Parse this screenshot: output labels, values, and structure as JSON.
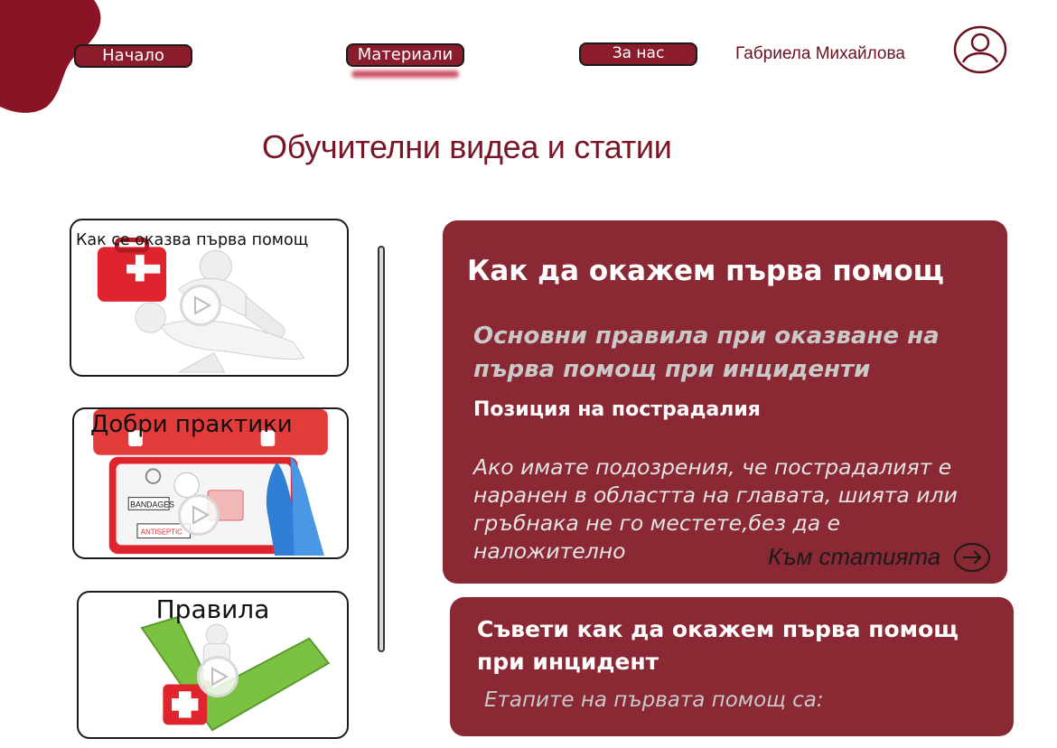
{
  "nav": {
    "home": "Начало",
    "materials": "Материали",
    "about": "За нас"
  },
  "user": {
    "name": "Габриела Михайлова",
    "avatar_icon": "user-circle-icon"
  },
  "page": {
    "title": "Обучителни видеа и статии"
  },
  "videos": [
    {
      "title": "Как се оказва първа помощ",
      "icon": "play-icon",
      "art": "cpr-figure-first-aid-kit"
    },
    {
      "title": "Добри практики",
      "icon": "play-icon",
      "art": "open-first-aid-kit",
      "labels": [
        "BANDAGES",
        "ANTISEPTIC"
      ]
    },
    {
      "title": "Правила",
      "icon": "play-icon",
      "art": "green-checkmark-first-aid-kit"
    }
  ],
  "articles": [
    {
      "title": "Как да окажем първа помощ",
      "subtitle": "Основни правила при оказване на първа помощ при инциденти",
      "section": "Позиция на пострадалия",
      "body": "Ако имате подозрения, че пострадалият е наранен в областта на главата, шията или гръбнака не го местете,без да е наложително",
      "link": "Към статията",
      "link_icon": "arrow-right-circle-icon"
    },
    {
      "title": "Съвети как да окажем първа помощ при инцидент",
      "body": "Етапите на първата помощ са:"
    }
  ],
  "colors": {
    "brand": "#8a1c2c",
    "card": "#8a2834",
    "accent_red": "#e0242e"
  }
}
